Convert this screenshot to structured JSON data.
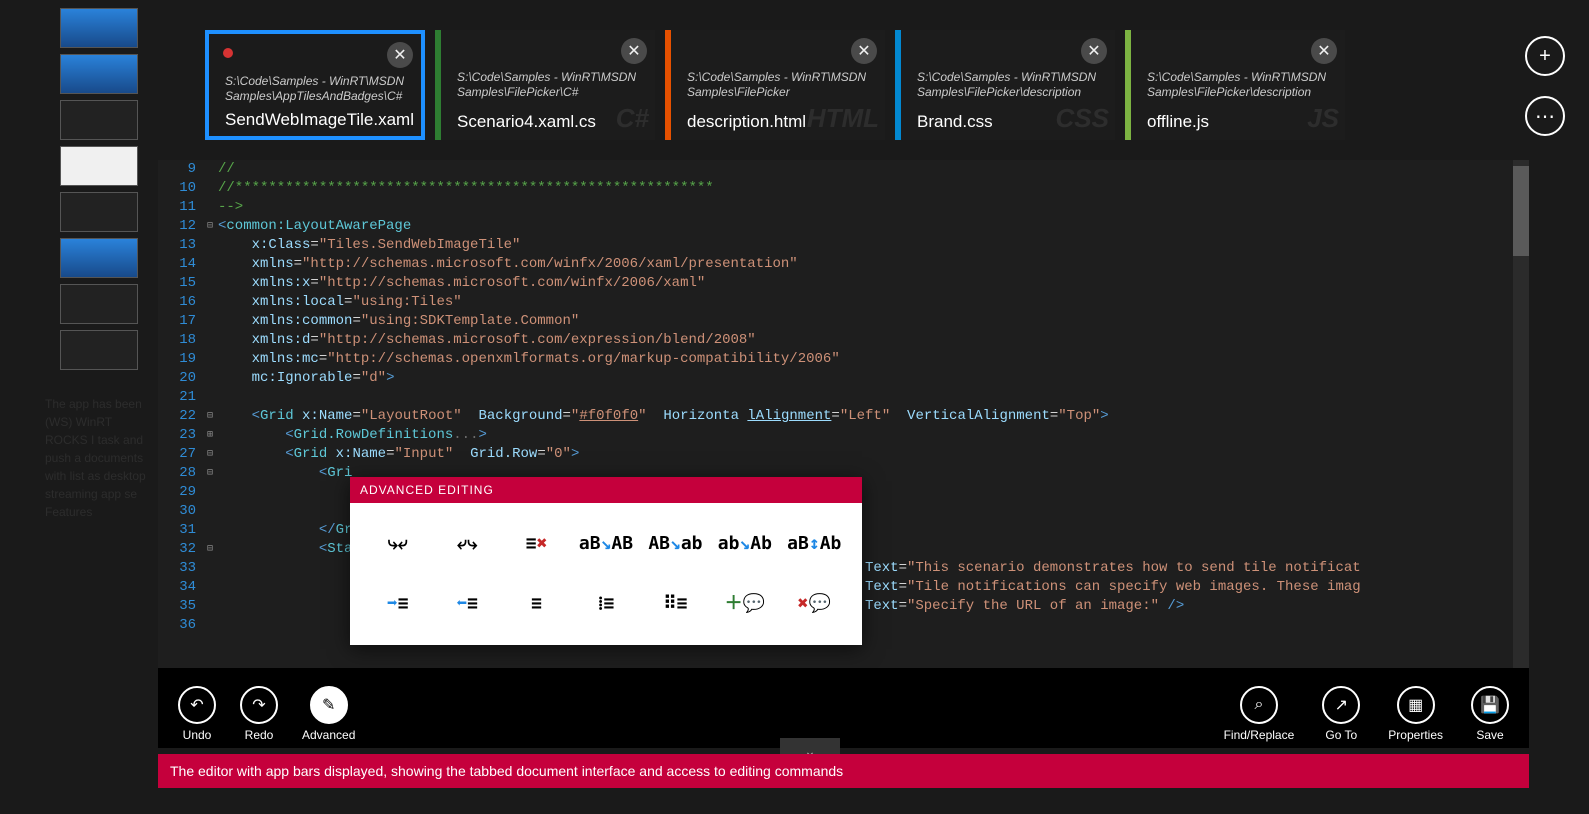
{
  "thumbnails": [
    1,
    2,
    3,
    4,
    5,
    6,
    7,
    8
  ],
  "tabs": [
    {
      "path": "S:\\Code\\Samples - WinRT\\MSDN Samples\\AppTilesAndBadges\\C#",
      "name": "SendWebImageTile.xaml",
      "lang": "",
      "color": "#1e90ff",
      "dirty": true,
      "active": true
    },
    {
      "path": "S:\\Code\\Samples - WinRT\\MSDN Samples\\FilePicker\\C#",
      "name": "Scenario4.xaml.cs",
      "lang": "C#",
      "color": "#2e7d32",
      "dirty": false,
      "active": false
    },
    {
      "path": "S:\\Code\\Samples - WinRT\\MSDN Samples\\FilePicker",
      "name": "description.html",
      "lang": "HTML",
      "color": "#e65100",
      "dirty": false,
      "active": false
    },
    {
      "path": "S:\\Code\\Samples - WinRT\\MSDN Samples\\FilePicker\\description",
      "name": "Brand.css",
      "lang": "CSS",
      "color": "#0288d1",
      "dirty": false,
      "active": false
    },
    {
      "path": "S:\\Code\\Samples - WinRT\\MSDN Samples\\FilePicker\\description",
      "name": "offline.js",
      "lang": "JS",
      "color": "#7cb342",
      "dirty": false,
      "active": false
    }
  ],
  "lines": [
    {
      "n": 9,
      "html": "<span class='c-cm'>//</span>"
    },
    {
      "n": 10,
      "html": "<span class='c-cm'>//*********************************************************</span>"
    },
    {
      "n": 11,
      "html": "<span class='c-cm'>--&gt;</span>"
    },
    {
      "n": 12,
      "html": "<span class='c-kw'>&lt;</span><span class='c-tag'>common:LayoutAwarePage</span>",
      "fold": "⊟"
    },
    {
      "n": 13,
      "html": "    <span class='c-attr'>x:Class</span>=<span class='c-str'>\"Tiles.SendWebImageTile\"</span>"
    },
    {
      "n": 14,
      "html": "    <span class='c-attr'>xmlns</span>=<span class='c-str'>\"http://schemas.microsoft.com/winfx/2006/xaml/presentation\"</span>"
    },
    {
      "n": 15,
      "html": "    <span class='c-attr'>xmlns:x</span>=<span class='c-str'>\"http://schemas.microsoft.com/winfx/2006/xaml\"</span>"
    },
    {
      "n": 16,
      "html": "    <span class='c-attr'>xmlns:local</span>=<span class='c-str'>\"using:Tiles\"</span>"
    },
    {
      "n": 17,
      "html": "    <span class='c-attr'>xmlns:common</span>=<span class='c-str'>\"using:SDKTemplate.Common\"</span>"
    },
    {
      "n": 18,
      "html": "    <span class='c-attr'>xmlns:d</span>=<span class='c-str'>\"http://schemas.microsoft.com/expression/blend/2008\"</span>"
    },
    {
      "n": 19,
      "html": "    <span class='c-attr'>xmlns:mc</span>=<span class='c-str'>\"http://schemas.openxmlformats.org/markup-compatibility/2006\"</span>"
    },
    {
      "n": 20,
      "html": "    <span class='c-attr'>mc:Ignorable</span>=<span class='c-str'>\"d\"</span><span class='c-kw'>&gt;</span>"
    },
    {
      "n": 21,
      "html": ""
    },
    {
      "n": 22,
      "html": "    <span class='c-kw'>&lt;</span><span class='c-tag'>Grid</span> <span class='c-attr'>x:Name</span>=<span class='c-str'>\"LayoutRoot\"</span>  <span class='c-attr'>Background</span>=<span class='c-str'>\"<u>#f0f0f0</u>\"</span>  <span class='c-attr'>Horizonta</span> <span class='c-attr'><u>lAlignment</u></span>=<span class='c-str'>\"Left\"</span>  <span class='c-attr'>VerticalAlignment</span>=<span class='c-str'>\"Top\"</span><span class='c-kw'>&gt;</span>",
      "fold": "⊟"
    },
    {
      "n": 23,
      "html": "        <span class='c-kw'>&lt;</span><span class='c-tag'>Grid.RowDefinitions</span><span class='c-dim'>...</span><span class='c-kw'>&gt;</span>",
      "fold": "⊞"
    },
    {
      "n": 27,
      "html": "        <span class='c-kw'>&lt;</span><span class='c-tag'>Grid</span> <span class='c-attr'>x:Name</span>=<span class='c-str'>\"Input\"</span>  <span class='c-attr'>Grid.Row</span>=<span class='c-str'>\"0\"</span><span class='c-kw'>&gt;</span>",
      "fold": "⊟"
    },
    {
      "n": 28,
      "html": "            <span class='c-kw'>&lt;</span><span class='c-tag'>Gri</span>",
      "fold": "⊟"
    },
    {
      "n": 29,
      "html": ""
    },
    {
      "n": 30,
      "html": ""
    },
    {
      "n": 31,
      "html": "            <span class='c-kw'>&lt;/</span><span class='c-tag'>Gr</span>"
    },
    {
      "n": 32,
      "html": "            <span class='c-kw'>&lt;</span><span class='c-tag'>Sta</span>",
      "fold": "⊟"
    },
    {
      "n": 33,
      "html": "                                                                  <span class='c-attr'>ing</span>=<span class='c-str'>\"Wrap\"</span> <span class='c-attr'>Text</span>=<span class='c-str'>\"This scenario demonstrates how to send tile notificat</span>"
    },
    {
      "n": 34,
      "html": "                                                                  <span class='c-attr'>ing</span>=<span class='c-str'>\"Wrap\"</span> <span class='c-attr'>Text</span>=<span class='c-str'>\"Tile notifications can specify web images. These imag</span>"
    },
    {
      "n": 35,
      "html": "                                                                  <span class='c-attr'>ing</span>=<span class='c-str'>\"Wrap\"</span> <span class='c-attr'>Text</span>=<span class='c-str'>\"Specify the URL of an image:\"</span> <span class='c-kw'>/&gt;</span>"
    },
    {
      "n": 36,
      "html": ""
    }
  ],
  "flyout": {
    "title": "ADVANCED EDITING"
  },
  "appbar": {
    "left": [
      {
        "id": "undo",
        "label": "Undo",
        "glyph": "↶"
      },
      {
        "id": "redo",
        "label": "Redo",
        "glyph": "↷"
      },
      {
        "id": "advanced",
        "label": "Advanced",
        "glyph": "✎",
        "active": true
      }
    ],
    "right": [
      {
        "id": "find",
        "label": "Find/Replace",
        "glyph": "⌕"
      },
      {
        "id": "goto",
        "label": "Go To",
        "glyph": "↗"
      },
      {
        "id": "properties",
        "label": "Properties",
        "glyph": "▦"
      },
      {
        "id": "save",
        "label": "Save",
        "glyph": "💾"
      }
    ]
  },
  "caption": "The editor with app bars displayed, showing the tabbed document interface and access to editing commands",
  "bgtext": "The app has been\n(WS) WinRT ROCKS I\ntask and push a\ndocuments with\nlist as desktop\nstreaming app se\n\nFeatures",
  "toolIcons": [
    "move-left",
    "move-right",
    "delete-line",
    "uppercase",
    "lowercase",
    "capitalize",
    "swap-case",
    "indent",
    "outdent",
    "format",
    "list-num",
    "list-bul",
    "comment",
    "uncomment"
  ]
}
